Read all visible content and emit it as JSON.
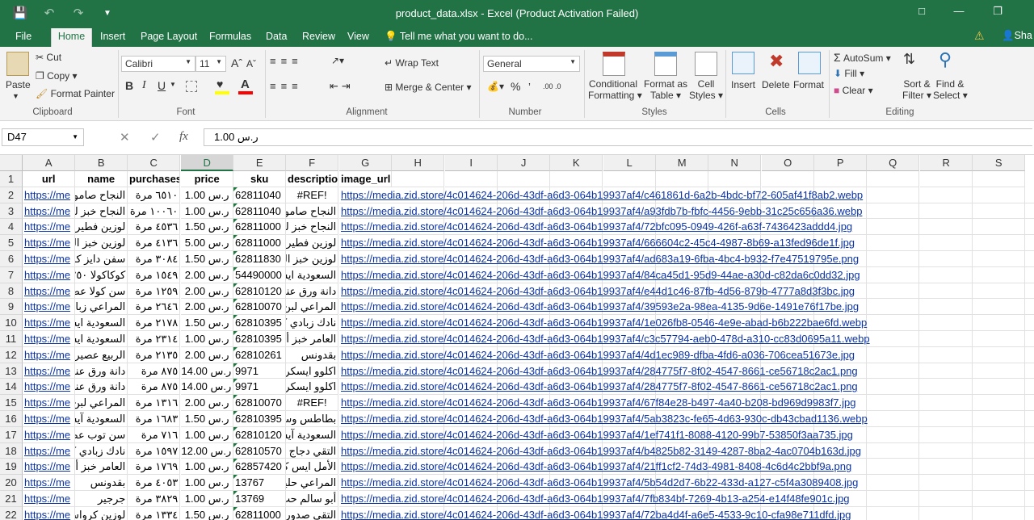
{
  "window": {
    "title": "product_data.xlsx - Excel (Product Activation Failed)",
    "qat_icons": [
      "save-icon",
      "undo-icon",
      "redo-icon",
      "customize-icon"
    ]
  },
  "tabs": [
    "File",
    "Home",
    "Insert",
    "Page Layout",
    "Formulas",
    "Data",
    "Review",
    "View"
  ],
  "active_tab": "Home",
  "tellme": "Tell me what you want to do...",
  "share": "Sha",
  "ribbon": {
    "clipboard": {
      "label": "Clipboard",
      "paste": "Paste",
      "cut": "Cut",
      "copy": "Copy",
      "format_painter": "Format Painter"
    },
    "font": {
      "label": "Font",
      "name": "Calibri",
      "size": "11",
      "bold": "B",
      "italic": "I",
      "underline": "U"
    },
    "alignment": {
      "label": "Alignment",
      "wrap_text": "Wrap Text",
      "merge_center": "Merge & Center"
    },
    "number": {
      "label": "Number",
      "format": "General",
      "percent": "%"
    },
    "styles": {
      "label": "Styles",
      "conditional": "Conditional",
      "conditional2": "Formatting",
      "format_as": "Format as",
      "format_as2": "Table",
      "cell": "Cell",
      "cell2": "Styles"
    },
    "cells": {
      "label": "Cells",
      "insert": "Insert",
      "delete": "Delete",
      "format": "Format"
    },
    "editing": {
      "label": "Editing",
      "autosum": "AutoSum",
      "fill": "Fill",
      "clear": "Clear",
      "sort": "Sort &",
      "sort2": "Filter",
      "find": "Find &",
      "find2": "Select"
    }
  },
  "formula_bar": {
    "name_box": "D47",
    "formula": "ر.س 1.00"
  },
  "columns": [
    "A",
    "B",
    "C",
    "D",
    "E",
    "F",
    "G",
    "H",
    "I",
    "J",
    "K",
    "L",
    "M",
    "N",
    "O",
    "P",
    "Q",
    "R",
    "S"
  ],
  "selected_column": "D",
  "header_row": [
    "url",
    "name",
    "purchases",
    "price",
    "sku",
    "description",
    "image_url"
  ],
  "rows": [
    {
      "n": "2",
      "url": "https://me",
      "name": "النجاح صامو",
      "purchases": "٦٥١٠ مرة",
      "price": "ر.س 1.00",
      "sku": "62811040",
      "desc": "#REF!",
      "img": "https://media.zid.store/4c014624-206d-43df-a6d3-064b19937af4/c461861d-6a2b-4bdc-bf72-605af41f8ab2.webp"
    },
    {
      "n": "3",
      "url": "https://me",
      "name": "النجاح خبز لبـ",
      "purchases": "١٠٠٦٠ مرة",
      "price": "ر.س 1.00",
      "sku": "62811040",
      "desc": "النجاح صامو",
      "img": "https://media.zid.store/4c014624-206d-43df-a6d3-064b19937af4/a93fdb7b-fbfc-4456-9ebb-31c25c656a36.webp"
    },
    {
      "n": "4",
      "url": "https://me",
      "name": "لوزين فطيرة",
      "purchases": "٤٥٣٦ مرة",
      "price": "ر.س 1.50",
      "sku": "62811000",
      "desc": "النجاح خبز لبـ",
      "img": "https://media.zid.store/4c014624-206d-43df-a6d3-064b19937af4/72bfc095-0949-426f-a63f-7436423addd4.jpg"
    },
    {
      "n": "5",
      "url": "https://me",
      "name": "لوزين خبز التو",
      "purchases": "٤١٣٦ مرة",
      "price": "ر.س 5.00",
      "sku": "62811000",
      "desc": "لوزين فطيرة",
      "img": "https://media.zid.store/4c014624-206d-43df-a6d3-064b19937af4/666604c2-45c4-4987-8b69-a13fed96de1f.jpg"
    },
    {
      "n": "6",
      "url": "https://me",
      "name": "سفن دايز كرو",
      "purchases": "٣٠٨٤ مرة",
      "price": "ر.س 1.50",
      "sku": "62811830",
      "desc": "لوزين خبز التو",
      "img": "https://media.zid.store/4c014624-206d-43df-a6d3-064b19937af4/ad683a19-6fba-4bc4-b932-f7e47519795e.png"
    },
    {
      "n": "7",
      "url": "https://me",
      "name": "كوكاكولا ٢٥٠",
      "purchases": "١٥٤٩ مرة",
      "price": "ر.س 2.00",
      "sku": "54490000",
      "desc": "السعودية ايس",
      "img": "https://media.zid.store/4c014624-206d-43df-a6d3-064b19937af4/84ca45d1-95d9-44ae-a30d-c82da6c0dd32.jpg"
    },
    {
      "n": "8",
      "url": "https://me",
      "name": "سن كولا عص",
      "purchases": "١٢٥٩ مرة",
      "price": "ر.س 2.00",
      "sku": "62810120",
      "desc": "دانة ورق عنـ",
      "img": "https://media.zid.store/4c014624-206d-43df-a6d3-064b19937af4/e44d1c46-87fb-4d56-879b-4777a8d3f3bc.jpg"
    },
    {
      "n": "9",
      "url": "https://me",
      "name": "المراعي زبادي",
      "purchases": "٢٦٤٦ مرة",
      "price": "ر.س 2.00",
      "sku": "62810070",
      "desc": "المراعي لبن كا",
      "img": "https://media.zid.store/4c014624-206d-43df-a6d3-064b19937af4/39593e2a-98ea-4135-9d6e-1491e76f17be.jpg"
    },
    {
      "n": "10",
      "url": "https://me",
      "name": "السعودية ايس",
      "purchases": "٢١٧٨ مرة",
      "price": "ر.س 1.50",
      "sku": "62810395",
      "desc": "نادك زبادي كا",
      "img": "https://media.zid.store/4c014624-206d-43df-a6d3-064b19937af4/1e026fb8-0546-4e9e-abad-b6b222bae6fd.webp"
    },
    {
      "n": "11",
      "url": "https://me",
      "name": "السعودية ايس",
      "purchases": "٢٣١٤ مرة",
      "price": "ر.س 1.00",
      "sku": "62810395",
      "desc": "العامر خبز أبيا",
      "img": "https://media.zid.store/4c014624-206d-43df-a6d3-064b19937af4/c3c57794-aeb0-478d-a310-cc83d0695a11.webp"
    },
    {
      "n": "12",
      "url": "https://me",
      "name": "الربيع عصير",
      "purchases": "٢١٣٥ مرة",
      "price": "ر.س 2.00",
      "sku": "62810261",
      "desc": "بقدونس",
      "img": "https://media.zid.store/4c014624-206d-43df-a6d3-064b19937af4/4d1ec989-dfba-4fd6-a036-706cea51673e.jpg"
    },
    {
      "n": "13",
      "url": "https://me",
      "name": "دانة ورق عنـ",
      "purchases": "٨٧٥ مرة",
      "price": "ر.س 14.00",
      "sku": "9971",
      "desc": "اكلوو ايسكريم",
      "img": "https://media.zid.store/4c014624-206d-43df-a6d3-064b19937af4/284775f7-8f02-4547-8661-ce56718c2ac1.png"
    },
    {
      "n": "14",
      "url": "https://me",
      "name": "دانة ورق عنـ",
      "purchases": "٨٧٥ مرة",
      "price": "ر.س 14.00",
      "sku": "9971",
      "desc": "اكلوو ايسكريم",
      "img": "https://media.zid.store/4c014624-206d-43df-a6d3-064b19937af4/284775f7-8f02-4547-8661-ce56718c2ac1.png"
    },
    {
      "n": "15",
      "url": "https://me",
      "name": "المراعي لبن كا",
      "purchases": "١٣١٦ مرة",
      "price": "ر.س 2.00",
      "sku": "62810070",
      "desc": "#REF!",
      "img": "https://media.zid.store/4c014624-206d-43df-a6d3-064b19937af4/67f84e28-b497-4a40-b208-bd969d9983f7.jpg"
    },
    {
      "n": "16",
      "url": "https://me",
      "name": "السعودية آيس",
      "purchases": "١٦٨٣ مرة",
      "price": "ر.س 1.50",
      "sku": "62810395",
      "desc": "بطاطس وسط",
      "img": "https://media.zid.store/4c014624-206d-43df-a6d3-064b19937af4/5ab3823c-fe65-4d63-930c-db43cbad1136.webp"
    },
    {
      "n": "17",
      "url": "https://me",
      "name": "سن توب عص",
      "purchases": "٧١٦ مرة",
      "price": "ر.س 1.00",
      "sku": "62810120",
      "desc": "السعودية آيس",
      "img": "https://media.zid.store/4c014624-206d-43df-a6d3-064b19937af4/1ef741f1-8088-4120-99b7-53850f3aa735.jpg"
    },
    {
      "n": "18",
      "url": "https://me",
      "name": "نادك زبادي كا",
      "purchases": "١٥٩٧ مرة",
      "price": "ر.س 12.00",
      "sku": "62810570",
      "desc": "التقي دجاج ٠",
      "img": "https://media.zid.store/4c014624-206d-43df-a6d3-064b19937af4/b4825b82-3149-4287-8ba2-4ac0704b163d.jpg"
    },
    {
      "n": "19",
      "url": "https://me",
      "name": "العامر خبز أبيا",
      "purchases": "١٧٦٩ مرة",
      "price": "ر.س 1.00",
      "sku": "62857420",
      "desc": "الأمل ايس كر",
      "img": "https://media.zid.store/4c014624-206d-43df-a6d3-064b19937af4/21ff1cf2-74d3-4981-8408-4c6d4c2bbf9a.png"
    },
    {
      "n": "20",
      "url": "https://me",
      "name": "بقدونس",
      "purchases": "٤٠٥٣ مرة",
      "price": "ر.س 1.00",
      "sku": "13767",
      "desc": "المراعي حليب",
      "img": "https://media.zid.store/4c014624-206d-43df-a6d3-064b19937af4/5b54d2d7-6b22-433d-a127-c5f4a3089408.jpg"
    },
    {
      "n": "21",
      "url": "https://me",
      "name": "جرجير",
      "purchases": "٣٨٢٩ مرة",
      "price": "ر.س 1.00",
      "sku": "13769",
      "desc": "أبو سالم حب",
      "img": "https://media.zid.store/4c014624-206d-43df-a6d3-064b19937af4/7fb834bf-7269-4b13-a254-e14f48fe901c.jpg"
    },
    {
      "n": "22",
      "url": "https://me",
      "name": "لوزين كرواسو",
      "purchases": "١٣٣٤ مرة",
      "price": "ر.س 1.50",
      "sku": "62811000",
      "desc": "التقي صدور",
      "img": "https://media.zid.store/4c014624-206d-43df-a6d3-064b19937af4/72ba4d4f-a6e5-4533-9c10-cfa98e711dfd.jpg"
    }
  ]
}
